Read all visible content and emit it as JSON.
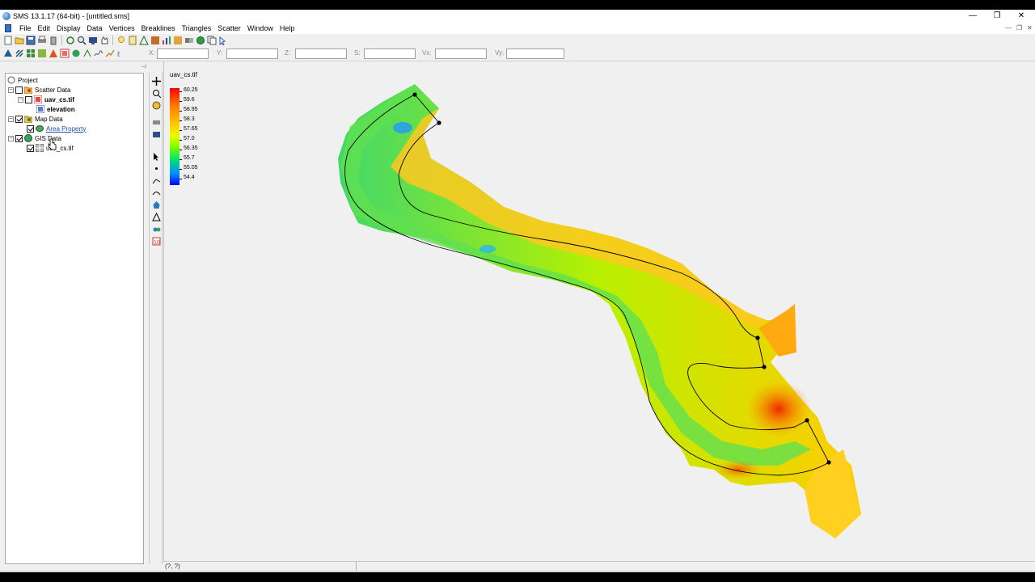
{
  "window": {
    "title": "SMS 13.1.17 (64-bit) - [untitled.sms]",
    "minimize": "—",
    "restore": "❐",
    "close": "✕"
  },
  "menu": [
    "File",
    "Edit",
    "Display",
    "Data",
    "Vertices",
    "Breaklines",
    "Triangles",
    "Scatter",
    "Window",
    "Help"
  ],
  "coords": {
    "x": "X:",
    "y": "Y:",
    "z": "Z:",
    "s": "S:",
    "vx": "Vx:",
    "vy": "Vy:"
  },
  "tree": {
    "project": "Project",
    "scatter_data": "Scatter Data",
    "uav_cs_tif": "uav_cs.tif",
    "elevation": "elevation",
    "map_data": "Map Data",
    "area_property": "Area Property",
    "gis_data": "GIS Data",
    "gis_uav_cs_tif": "uav_cs.tif"
  },
  "legend": {
    "title": "uav_cs.tif",
    "values": [
      "60.25",
      "59.6",
      "58.95",
      "58.3",
      "57.65",
      "57.0",
      "56.35",
      "55.7",
      "55.05",
      "54.4"
    ],
    "colors": {
      "max": "#ff0000",
      "mid": "#e6ff00",
      "min": "#0000ff"
    }
  },
  "status": {
    "cursor_coords": "(?, ?)"
  }
}
